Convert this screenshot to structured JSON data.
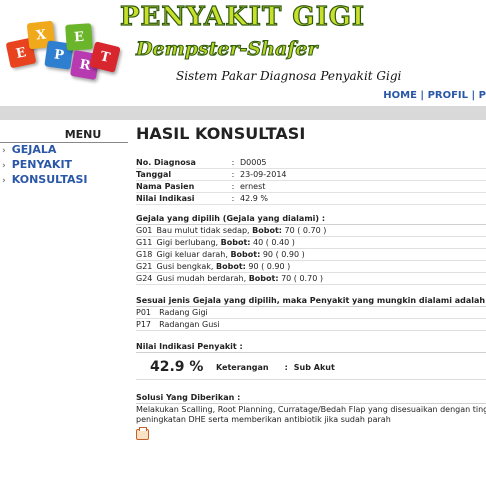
{
  "header": {
    "cubes": [
      "E",
      "X",
      "P",
      "E",
      "R",
      "T"
    ],
    "title": "PENYAKIT GIGI",
    "subtitle": "Dempster-Shafer",
    "tagline": "Sistem Pakar Diagnosa Penyakit Gigi",
    "nav": [
      "HOME",
      "PROFIL",
      "P"
    ]
  },
  "menu": {
    "title": "MENU",
    "items": [
      "GEJALA",
      "PENYAKIT",
      "KONSULTASI"
    ]
  },
  "page_title": "HASIL KONSULTASI",
  "info": [
    {
      "label": "No. Diagnosa",
      "value": "D0005"
    },
    {
      "label": "Tanggal",
      "value": "23-09-2014"
    },
    {
      "label": "Nama Pasien",
      "value": "ernest"
    },
    {
      "label": "Nilai Indikasi",
      "value": "42.9 %"
    }
  ],
  "gejala": {
    "title": "Gejala yang dipilih (Gejala yang dialami) :",
    "items": [
      {
        "code": "G01",
        "name": "Bau mulut tidak sedap,",
        "bobot_label": "Bobot:",
        "bobot": "70 ( 0.70 )"
      },
      {
        "code": "G11",
        "name": "Gigi berlubang,",
        "bobot_label": "Bobot:",
        "bobot": "40 ( 0.40 )"
      },
      {
        "code": "G18",
        "name": "Gigi keluar darah,",
        "bobot_label": "Bobot:",
        "bobot": "90 ( 0.90 )"
      },
      {
        "code": "G21",
        "name": "Gusi bengkak,",
        "bobot_label": "Bobot:",
        "bobot": "90 ( 0.90 )"
      },
      {
        "code": "G24",
        "name": "Gusi mudah berdarah,",
        "bobot_label": "Bobot:",
        "bobot": "70 ( 0.70 )"
      }
    ]
  },
  "penyakit": {
    "title": "Sesuai jenis Gejala yang dipilih, maka Penyakit yang mungkin dialami adalah :",
    "items": [
      {
        "code": "P01",
        "name": "Radang Gigi"
      },
      {
        "code": "P17",
        "name": "Radangan Gusi"
      }
    ]
  },
  "nilai": {
    "title": "Nilai Indikasi Penyakit :",
    "value": "42.9 %",
    "ket_label": "Keterangan",
    "ket_value": "Sub Akut"
  },
  "solusi": {
    "title": "Solusi Yang Diberikan :",
    "line1": "Melakukan Scalling, Root Planning, Curratage/Bedah Flap yang disesuaikan dengan tingkat keparaha",
    "line2": "peningkatan DHE serta memberikan antibiotik jika sudah parah"
  }
}
